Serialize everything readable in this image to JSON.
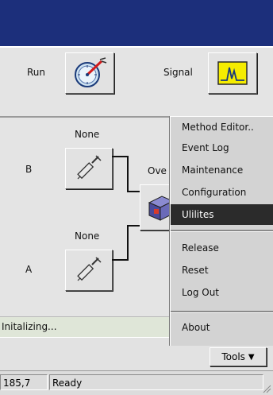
{
  "toolbar": {
    "run_label": "Run",
    "signal_label": "Signal"
  },
  "channels": {
    "b": {
      "label": "B",
      "injector": "None"
    },
    "a": {
      "label": "A",
      "injector": "None"
    },
    "oven_label_partial": "Ove"
  },
  "menu": {
    "items": [
      {
        "label": "Method Editor..",
        "selected": false
      },
      {
        "label": "Event Log",
        "selected": false
      },
      {
        "label": "Maintenance",
        "selected": false
      },
      {
        "label": "Configuration",
        "selected": false
      },
      {
        "label": "Ulilites",
        "selected": true
      },
      {
        "label": "Release",
        "selected": false
      },
      {
        "label": "Reset",
        "selected": false
      },
      {
        "label": "Log Out",
        "selected": false
      },
      {
        "label": "About",
        "selected": false
      }
    ]
  },
  "status": {
    "message": "Initalizing...",
    "coordinate": "185,7",
    "state": "Ready"
  },
  "tools": {
    "label": "Tools"
  },
  "colors": {
    "titlebar": "#1c2f7b",
    "menu_selected": "#2b2b2b",
    "signal_icon_bg": "#f5ec00"
  }
}
